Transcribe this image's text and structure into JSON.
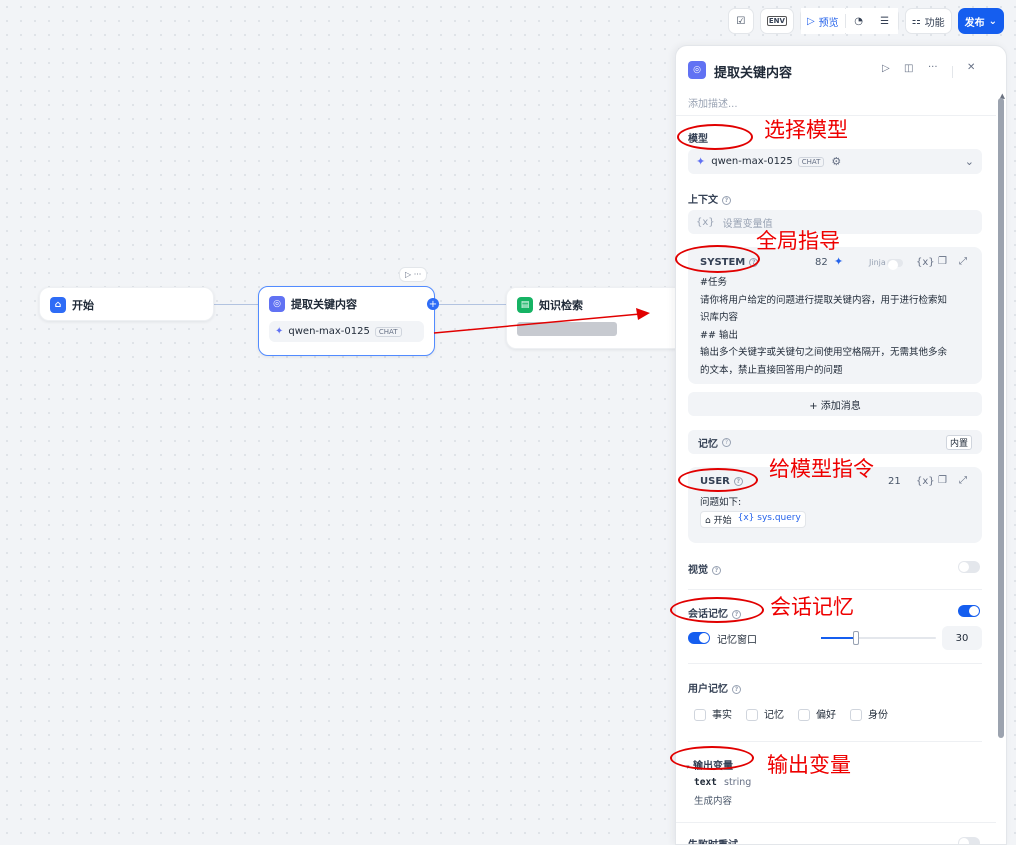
{
  "toolbar": {
    "preview_label": "预览",
    "features_label": "功能",
    "publish_label": "发布",
    "env_label": "ENV"
  },
  "canvas": {
    "start_node": {
      "title": "开始"
    },
    "llm_node": {
      "title": "提取关键内容",
      "model": "qwen-max-0125",
      "model_mode": "CHAT"
    },
    "knowledge_node": {
      "title": "知识检索"
    }
  },
  "panel": {
    "title": "提取关键内容",
    "description_placeholder": "添加描述...",
    "model_section": {
      "label": "模型",
      "model_name": "qwen-max-0125",
      "mode": "CHAT"
    },
    "context_section": {
      "label": "上下文",
      "placeholder": "设置变量值"
    },
    "system_prompt": {
      "role": "SYSTEM",
      "token_count": "82",
      "jinja_label": "Jinja",
      "lines": [
        "#任务",
        "请你将用户给定的问题进行提取关键内容，用于进行检索知",
        "识库内容",
        "## 输出",
        "输出多个关键字或关键句之间使用空格隔开，无需其他多余",
        "的文本，禁止直接回答用户的问题"
      ]
    },
    "add_message_label": "+ 添加消息",
    "memory_row": {
      "label": "记忆",
      "badge": "内置"
    },
    "user_prompt": {
      "role": "USER",
      "token_count": "21",
      "text": "问题如下:",
      "var_source": "开始",
      "var_name": "sys.query"
    },
    "vision": {
      "label": "视觉"
    },
    "conversation_memory": {
      "label": "会话记忆",
      "window_label": "记忆窗口",
      "window_value": "30",
      "window_fraction": 0.3
    },
    "user_memory": {
      "label": "用户记忆",
      "options": [
        "事实",
        "记忆",
        "偏好",
        "身份"
      ]
    },
    "output_vars": {
      "label": "输出变量",
      "var_name": "text",
      "var_type": "string",
      "var_desc": "生成内容"
    },
    "retry": {
      "label": "失败时重试"
    }
  },
  "annotations": {
    "select_model": "选择模型",
    "global_guide": "全局指导",
    "model_instruction": "给模型指令",
    "conversation_memory": "会话记忆",
    "output_variable": "输出变量"
  },
  "colors": {
    "accent": "#155eef",
    "annotation": "#ee0000"
  }
}
